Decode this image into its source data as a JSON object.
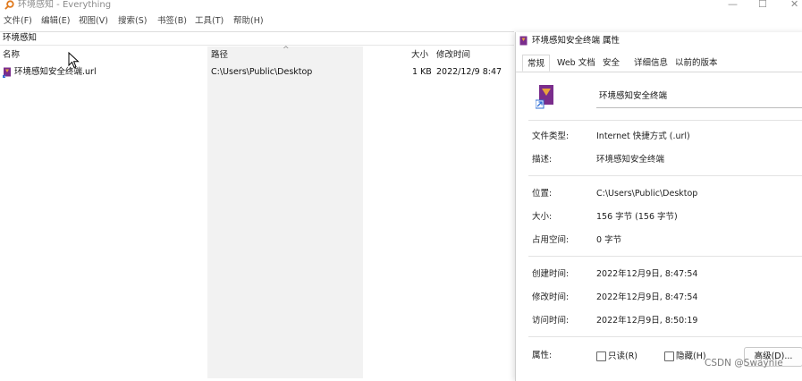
{
  "window": {
    "title": "环境感知 - Everything",
    "controls": {
      "minimize": "—",
      "maximize": "☐",
      "close": "✕"
    }
  },
  "menu": [
    "文件(F)",
    "编辑(E)",
    "视图(V)",
    "搜索(S)",
    "书签(B)",
    "工具(T)",
    "帮助(H)"
  ],
  "search": {
    "value": "环境感知"
  },
  "columns": {
    "name": "名称",
    "path": "路径",
    "size": "大小",
    "modified": "修改时间",
    "sort_arrow": "^"
  },
  "results": [
    {
      "name": "环境感知安全终端.url",
      "path": "C:\\Users\\Public\\Desktop",
      "size": "1 KB",
      "modified": "2022/12/9 8:47"
    }
  ],
  "dialog": {
    "title": "环境感知安全终端 属性",
    "tabs": [
      "常规",
      "Web 文档",
      "安全",
      "详细信息",
      "以前的版本"
    ],
    "active_tab": "常规",
    "file_name": "环境感知安全终端",
    "fields": {
      "type_label": "文件类型:",
      "type_value": "Internet 快捷方式 (.url)",
      "desc_label": "描述:",
      "desc_value": "环境感知安全终端",
      "location_label": "位置:",
      "location_value": "C:\\Users\\Public\\Desktop",
      "size_label": "大小:",
      "size_value": "156 字节 (156 字节)",
      "disk_label": "占用空间:",
      "disk_value": "0 字节",
      "created_label": "创建时间:",
      "created_value": "2022年12月9日, 8:47:54",
      "modified_label": "修改时间:",
      "modified_value": "2022年12月9日, 8:47:54",
      "accessed_label": "访问时间:",
      "accessed_value": "2022年12月9日, 8:50:19",
      "attr_label": "属性:"
    },
    "attributes": {
      "readonly": "只读(R)",
      "hidden": "隐藏(H)",
      "advanced_button": "高级(D)..."
    }
  },
  "watermark": "CSDN @Swaynie",
  "colors": {
    "icon_accent": "#e9a23b",
    "icon_doc": "#7a2d8c",
    "shortcut_arrow": "#2f6fd6"
  }
}
